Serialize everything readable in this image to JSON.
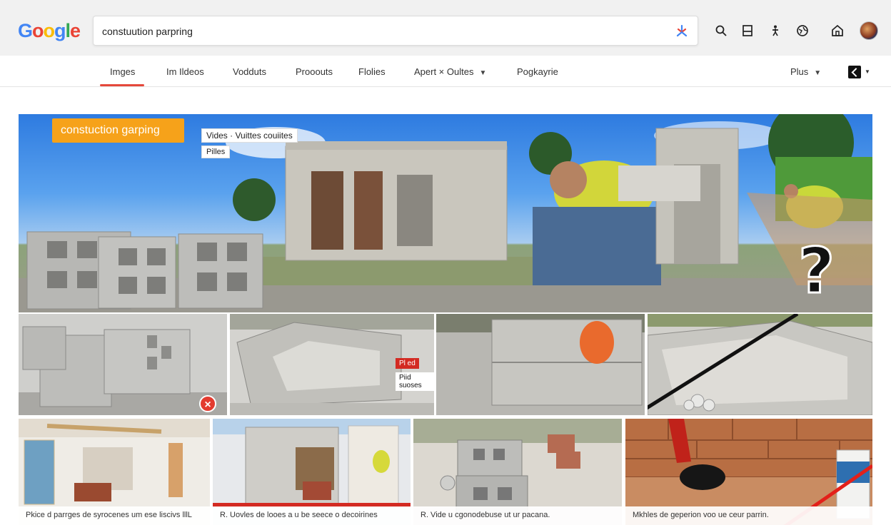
{
  "logo": {
    "letters": [
      "G",
      "o",
      "o",
      "g",
      "l",
      "e"
    ]
  },
  "search": {
    "query": "constuution parpring"
  },
  "toolbar": {
    "icons": [
      "search-icon",
      "bookmark-icon",
      "person-icon",
      "globe-icon",
      "home-icon"
    ]
  },
  "tabs": [
    {
      "label": "Imges",
      "active": true
    },
    {
      "label": "Im Ildeos"
    },
    {
      "label": "Vodduts"
    },
    {
      "label": "Prooouts"
    },
    {
      "label": "Flolies"
    },
    {
      "label": "Apert × Oultes",
      "dropdown": true
    },
    {
      "label": "Pogkayrie"
    }
  ],
  "more": {
    "label": "Plus"
  },
  "hero": {
    "badge": "constuction garping",
    "tag1": "Vides · Vuittes couiites",
    "tag2": "Pilles"
  },
  "row2": {
    "thumb2_label": "Piid suoses",
    "thumb2_label_red": "Pl ed"
  },
  "row3": {
    "captions": [
      "Pkice d parrges de syrocenes um ese liscivs lllL",
      "R. Uovles de looes a u be seece o decoirines",
      "R. Vide u cgonodebuse ut ur pacana.",
      "Mkhles de geperion voo ue ceur parrin."
    ]
  },
  "colors": {
    "accent": "#e5483b",
    "badge": "#f6a21a",
    "close": "#e33b2f"
  }
}
